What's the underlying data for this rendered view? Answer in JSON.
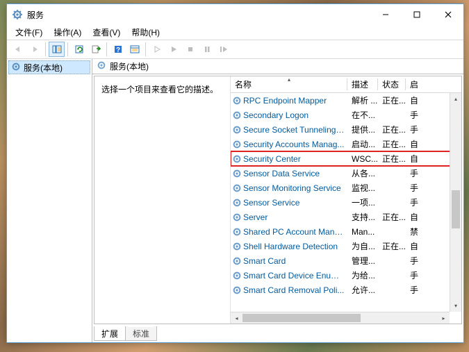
{
  "window": {
    "title": "服务"
  },
  "menus": {
    "file": "文件(F)",
    "action": "操作(A)",
    "view": "查看(V)",
    "help": "帮助(H)"
  },
  "tree": {
    "root": "服务(本地)"
  },
  "header_title": "服务(本地)",
  "description": "选择一个项目来查看它的描述。",
  "columns": {
    "name": "名称",
    "desc": "描述",
    "status": "状态",
    "startup": "启"
  },
  "services": [
    {
      "name": "RPC Endpoint Mapper",
      "desc": "解析 ...",
      "status": "正在...",
      "startup": "自"
    },
    {
      "name": "Secondary Logon",
      "desc": "在不...",
      "status": "",
      "startup": "手"
    },
    {
      "name": "Secure Socket Tunneling ...",
      "desc": "提供...",
      "status": "正在...",
      "startup": "手"
    },
    {
      "name": "Security Accounts Manag...",
      "desc": "启动...",
      "status": "正在...",
      "startup": "自"
    },
    {
      "name": "Security Center",
      "desc": "WSC...",
      "status": "正在...",
      "startup": "自",
      "highlighted": true
    },
    {
      "name": "Sensor Data Service",
      "desc": "从各...",
      "status": "",
      "startup": "手"
    },
    {
      "name": "Sensor Monitoring Service",
      "desc": "监视...",
      "status": "",
      "startup": "手"
    },
    {
      "name": "Sensor Service",
      "desc": "一项...",
      "status": "",
      "startup": "手"
    },
    {
      "name": "Server",
      "desc": "支持...",
      "status": "正在...",
      "startup": "自"
    },
    {
      "name": "Shared PC Account Mana...",
      "desc": "Man...",
      "status": "",
      "startup": "禁"
    },
    {
      "name": "Shell Hardware Detection",
      "desc": "为自...",
      "status": "正在...",
      "startup": "自"
    },
    {
      "name": "Smart Card",
      "desc": "管理...",
      "status": "",
      "startup": "手"
    },
    {
      "name": "Smart Card Device Enum...",
      "desc": "为给...",
      "status": "",
      "startup": "手"
    },
    {
      "name": "Smart Card Removal Poli...",
      "desc": "允许...",
      "status": "",
      "startup": "手"
    }
  ],
  "tabs": {
    "extended": "扩展",
    "standard": "标准"
  }
}
